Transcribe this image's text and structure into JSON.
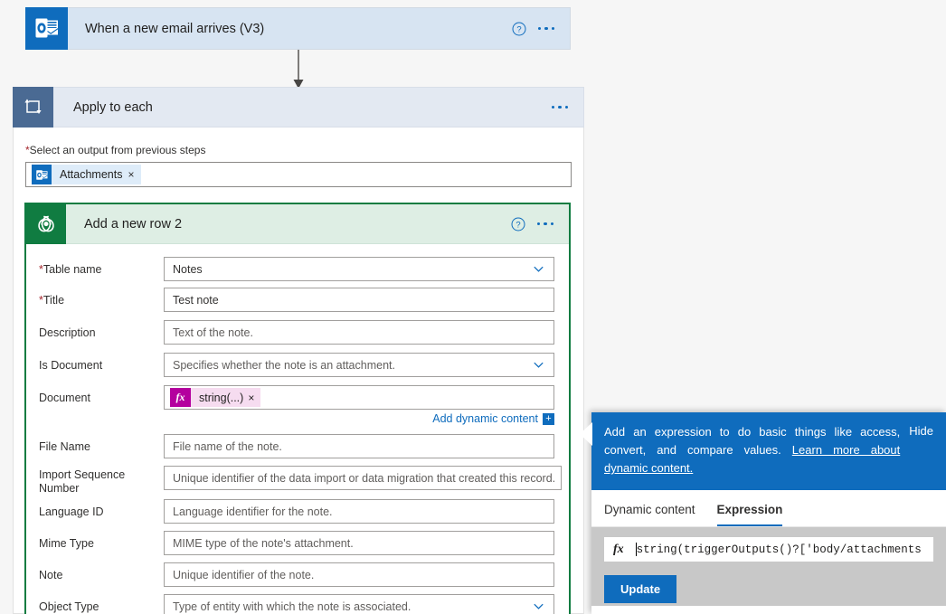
{
  "trigger": {
    "title": "When a new email arrives (V3)",
    "icon": "outlook-icon",
    "help_icon": "help-circle-icon",
    "menu_icon": "ellipsis-icon",
    "accent": "#0f6cbd",
    "header_bg": "#d7e4f2"
  },
  "scope": {
    "title": "Apply to each",
    "icon": "loop-icon",
    "menu_icon": "ellipsis-icon",
    "field_label": "Select an output from previous steps",
    "required_marker": "*",
    "token": {
      "label": "Attachments",
      "icon": "outlook-icon",
      "remove": "×"
    },
    "header_bg": "#e3e9f2",
    "accent": "#4a6a93"
  },
  "action": {
    "title": "Add a new row 2",
    "icon": "dataverse-icon",
    "help_icon": "help-circle-icon",
    "menu_icon": "ellipsis-icon",
    "accent": "#107c41",
    "header_bg": "#deeee4",
    "fields": [
      {
        "label": "Table name",
        "required": true,
        "value": "Notes",
        "is_placeholder": false,
        "dropdown": true
      },
      {
        "label": "Title",
        "required": true,
        "value": "Test note",
        "is_placeholder": false,
        "dropdown": false
      },
      {
        "label": "Description",
        "required": false,
        "value": "Text of the note.",
        "is_placeholder": true,
        "dropdown": false
      },
      {
        "label": "Is Document",
        "required": false,
        "value": "Specifies whether the note is an attachment.",
        "is_placeholder": true,
        "dropdown": true
      },
      {
        "label": "Document",
        "required": false,
        "value": "",
        "is_placeholder": true,
        "dropdown": false,
        "token": true
      },
      {
        "label": "File Name",
        "required": false,
        "value": "File name of the note.",
        "is_placeholder": true,
        "dropdown": false
      },
      {
        "label": "Import Sequence Number",
        "required": false,
        "value": "Unique identifier of the data import or data migration that created this record.",
        "is_placeholder": true,
        "dropdown": false
      },
      {
        "label": "Language ID",
        "required": false,
        "value": "Language identifier for the note.",
        "is_placeholder": true,
        "dropdown": false
      },
      {
        "label": "Mime Type",
        "required": false,
        "value": "MIME type of the note's attachment.",
        "is_placeholder": true,
        "dropdown": false
      },
      {
        "label": "Note",
        "required": false,
        "value": "Unique identifier of the note.",
        "is_placeholder": true,
        "dropdown": false
      },
      {
        "label": "Object Type",
        "required": false,
        "value": "Type of entity with which the note is associated.",
        "is_placeholder": true,
        "dropdown": true
      }
    ],
    "document_token": {
      "fx": "fx",
      "label": "string(...)",
      "remove": "×",
      "chip_bg": "#f6dcf0",
      "fx_bg": "#b4009e"
    },
    "dynamic_content": {
      "link": "Add dynamic content",
      "plus": "+"
    }
  },
  "panel": {
    "banner": {
      "text_before": "Add an expression to do basic things like access, convert, and compare values. ",
      "link": "Learn more about dynamic content.",
      "hide": "Hide",
      "bg": "#0f6cbd"
    },
    "tabs": [
      {
        "label": "Dynamic content",
        "active": false
      },
      {
        "label": "Expression",
        "active": true
      }
    ],
    "editor": {
      "fx": "fx",
      "expression": "string(triggerOutputs()?['body/attachments",
      "update_label": "Update"
    }
  }
}
